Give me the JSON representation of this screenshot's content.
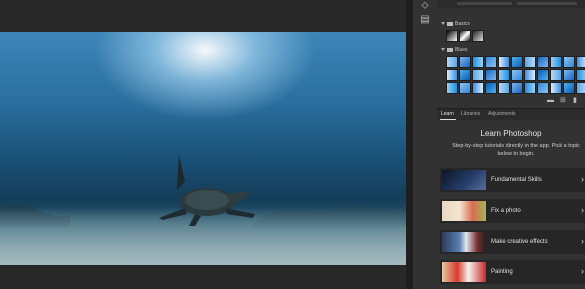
{
  "app": {
    "name": "Photoshop"
  },
  "gradients": {
    "groups": [
      {
        "label": "Basics"
      },
      {
        "label": "Blues"
      }
    ]
  },
  "tabs": [
    {
      "label": "Learn"
    },
    {
      "label": "Libraries"
    },
    {
      "label": "Adjustments"
    }
  ],
  "learn": {
    "title": "Learn Photoshop",
    "description": "Step-by-step tutorials directly in the app. Pick a topic below to begin.",
    "tutorials": [
      {
        "label": "Fundamental Skills"
      },
      {
        "label": "Fix a photo"
      },
      {
        "label": "Make creative effects"
      },
      {
        "label": "Painting"
      }
    ]
  },
  "colors": {
    "panel_bg": "#323232",
    "app_bg": "#282828"
  }
}
